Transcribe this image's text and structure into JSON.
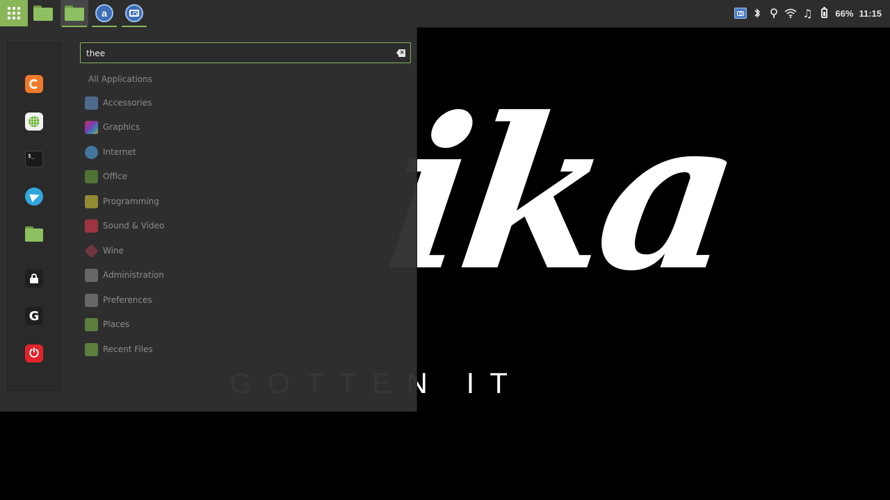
{
  "wallpaper": {
    "script_text": "ika",
    "tagline": "GOTTEN IT"
  },
  "panel": {
    "menu_icon": "grid-icon",
    "tasks": [
      {
        "name": "Files",
        "icon": "folder-icon"
      },
      {
        "name": "Files",
        "icon": "folder-icon"
      },
      {
        "name": "a",
        "icon": "app-a-icon"
      },
      {
        "name": "Screenshot",
        "icon": "camera-icon"
      }
    ],
    "tray": {
      "battery_percent": "66%",
      "clock": "11:15",
      "icons": [
        "screenshot-icon",
        "bluetooth-icon",
        "location-icon",
        "wifi-icon",
        "music-icon",
        "battery-icon"
      ]
    }
  },
  "menu": {
    "search": {
      "value": "thee"
    },
    "favorites": [
      {
        "name": "Firefox",
        "icon": "firefox-icon"
      },
      {
        "name": "Software Manager",
        "icon": "software-manager-icon"
      },
      {
        "name": "Terminal",
        "icon": "terminal-icon",
        "glyph": "$_"
      },
      {
        "name": "Telegram",
        "icon": "telegram-icon"
      },
      {
        "name": "Files",
        "icon": "folder-icon"
      },
      {
        "name": "Lock Screen",
        "icon": "lock-icon"
      },
      {
        "name": "Logout",
        "icon": "logout-icon",
        "glyph": "G"
      },
      {
        "name": "Quit",
        "icon": "power-icon",
        "glyph": "⏻"
      }
    ],
    "categories_header": "All Applications",
    "categories": [
      {
        "label": "Accessories",
        "icon": "accessories-icon"
      },
      {
        "label": "Graphics",
        "icon": "graphics-icon"
      },
      {
        "label": "Internet",
        "icon": "internet-icon"
      },
      {
        "label": "Office",
        "icon": "office-icon"
      },
      {
        "label": "Programming",
        "icon": "programming-icon"
      },
      {
        "label": "Sound & Video",
        "icon": "sound-video-icon"
      },
      {
        "label": "Wine",
        "icon": "wine-icon"
      },
      {
        "label": "Administration",
        "icon": "administration-icon"
      },
      {
        "label": "Preferences",
        "icon": "preferences-icon"
      },
      {
        "label": "Places",
        "icon": "places-icon"
      },
      {
        "label": "Recent Files",
        "icon": "recent-files-icon"
      }
    ]
  },
  "colors": {
    "accent": "#8ab65a",
    "panel_bg": "#2d2d2d",
    "menu_bg": "#303030"
  }
}
